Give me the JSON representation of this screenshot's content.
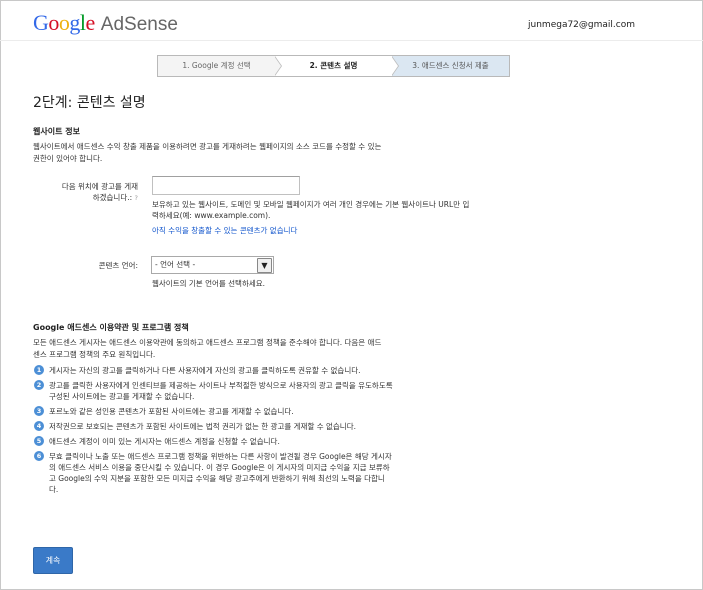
{
  "header": {
    "logo": {
      "g1": "G",
      "o1": "o",
      "o2": "o",
      "g2": "g",
      "l": "l",
      "e": "e"
    },
    "product": "AdSense",
    "email": "junmega72@gmail.com"
  },
  "steps": [
    {
      "label": "1. Google 계정 선택"
    },
    {
      "label": "2. 콘텐츠 설명"
    },
    {
      "label": "3. 애드센스 신청서 제출"
    }
  ],
  "page_title": "2단계: 콘텐츠 설명",
  "website": {
    "section_title": "웹사이트 정보",
    "description": "웹사이트에서 애드센스 수익 창출 제품을 이용하려면 광고를 게재하려는 웹페이지의 소스 코드를 수정할 수 있는 권한이 있어야 합니다.",
    "url_label_line1": "다음 위치에 광고를 게재",
    "url_label_line2": "하겠습니다.:",
    "help_mark": "?",
    "url_value": "",
    "url_hint": "보유하고 있는 웹사이트, 도메인 및 모바일 웹페이지가 여러 개인 경우에는 기본 웹사이트나 URL만 입력하세요(예: www.example.com).",
    "no_content_link": "아직 수익을 창출할 수 있는 콘텐츠가 없습니다",
    "language_label": "콘텐츠 언어:",
    "language_selected": "- 언어 선택 -",
    "language_hint": "웹사이트의 기본 언어를 선택하세요."
  },
  "policy": {
    "section_title": "Google 애드센스 이용약관 및 프로그램 정책",
    "intro": "모든 애드센스 게시자는 애드센스 이용약관에 동의하고 애드센스 프로그램 정책을 준수해야 합니다. 다음은 애드센스 프로그램 정책의 주요 원칙입니다.",
    "items": [
      {
        "num": "1",
        "text": "게시자는 자신의 광고를 클릭하거나 다른 사용자에게 자신의 광고를 클릭하도록 권유할 수 없습니다."
      },
      {
        "num": "2",
        "text": "광고를 클릭한 사용자에게 인센티브를 제공하는 사이트나 부적절한 방식으로 사용자의 광고 클릭을 유도하도록 구성된 사이트에는 광고를 게재할 수 없습니다."
      },
      {
        "num": "3",
        "text": "포르노와 같은 성인용 콘텐츠가 포함된 사이트에는 광고를 게재할 수 없습니다."
      },
      {
        "num": "4",
        "text": "저작권으로 보호되는 콘텐츠가 포함된 사이트에는 법적 권리가 없는 한 광고를 게재할 수 없습니다."
      },
      {
        "num": "5",
        "text": "애드센스 계정이 이미 있는 게시자는 애드센스 계정을 신청할 수 없습니다."
      },
      {
        "num": "6",
        "text": "무효 클릭이나 노출 또는 애드센스 프로그램 정책을 위반하는 다른 사항이 발견될 경우 Google은 해당 게시자의 애드센스 서비스 이용을 중단시킬 수 있습니다. 이 경우 Google은 이 게시자의 미지급 수익을 지급 보류하고 Google의 수익 지분을 포함한 모든 미지급 수익을 해당 광고주에게 반환하기 위해 최선의 노력을 다합니다."
      }
    ]
  },
  "continue_button": "계속",
  "colors": {
    "accent": "#3a7ac8",
    "link": "#1155cc",
    "step_active_bg": "#ffffff",
    "step_next_bg": "#dbe7f2"
  }
}
